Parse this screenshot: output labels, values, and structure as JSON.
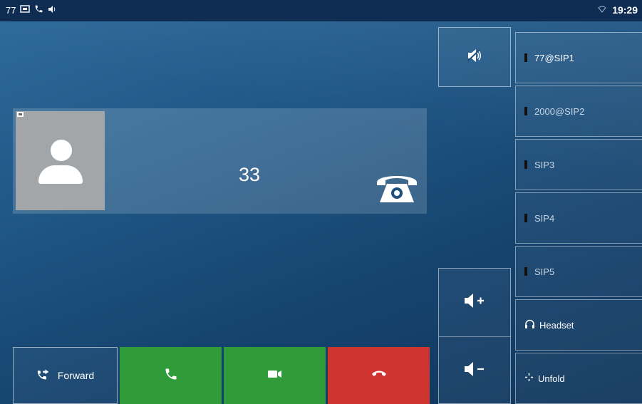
{
  "statusbar": {
    "account": "77",
    "icons": [
      "voicemail-icon",
      "phone-icon",
      "speaker-icon"
    ],
    "wifi_icon": "wifi-icon",
    "time": "19:29"
  },
  "call": {
    "number": "33",
    "avatar_icon": "person-icon",
    "call_type_icon": "telephone-icon"
  },
  "line_keys": [
    {
      "label": "77@SIP1",
      "registered": true
    },
    {
      "label": "2000@SIP2",
      "registered": false
    },
    {
      "label": "SIP3",
      "registered": false
    },
    {
      "label": "SIP4",
      "registered": false
    },
    {
      "label": "SIP5",
      "registered": false
    }
  ],
  "function_keys": {
    "headset": "Headset",
    "unfold": "Unfold"
  },
  "softkeys": {
    "forward": "Forward",
    "answer_icon": "handset-icon",
    "video_icon": "video-camera-icon",
    "reject_icon": "hang-up-icon"
  },
  "colors": {
    "answer": "#2f9c39",
    "reject": "#cf3431",
    "statusbar": "#0f2d52"
  }
}
